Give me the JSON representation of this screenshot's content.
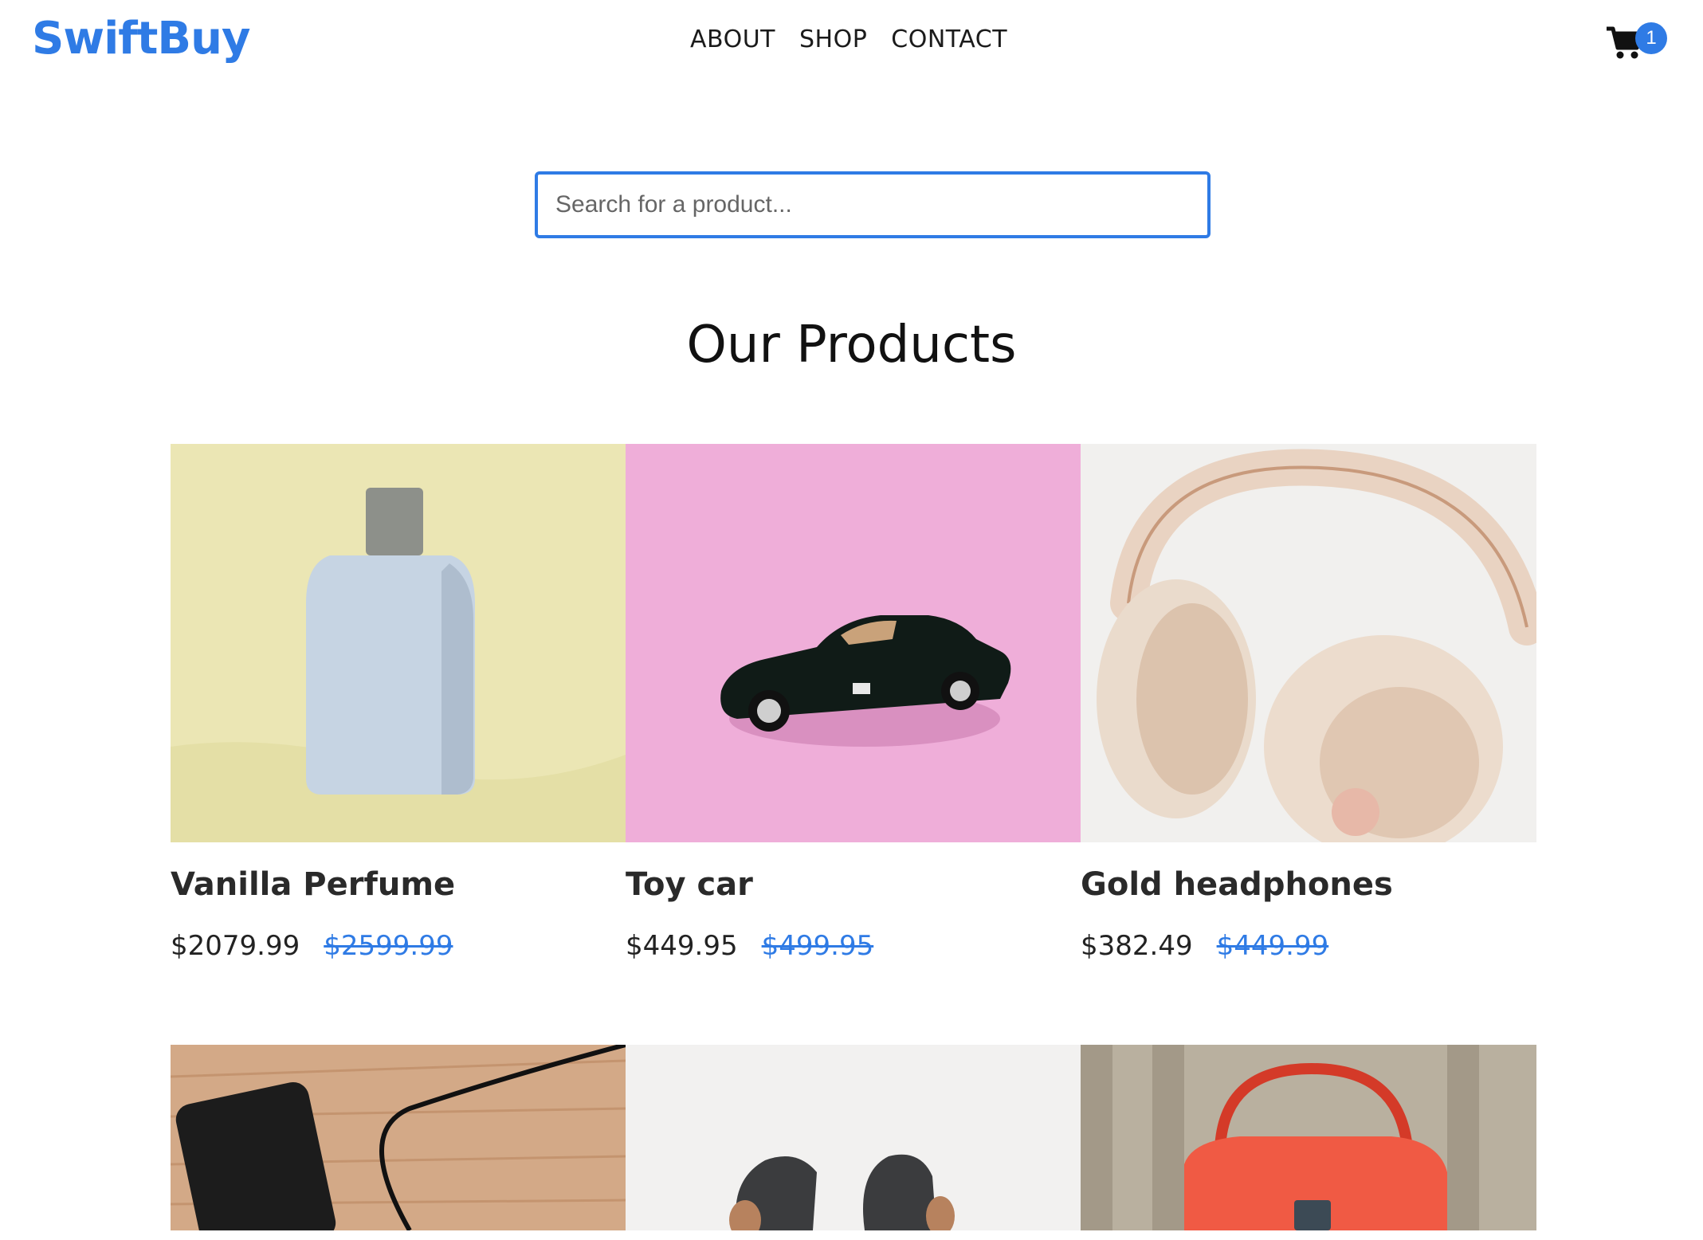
{
  "brand": {
    "name": "SwiftBuy",
    "color": "#2f7be5"
  },
  "nav": [
    {
      "label": "ABOUT"
    },
    {
      "label": "SHOP"
    },
    {
      "label": "CONTACT"
    }
  ],
  "cart": {
    "icon": "cart-icon",
    "count": "1"
  },
  "search": {
    "placeholder": "Search for a product..."
  },
  "section": {
    "title": "Our Products"
  },
  "products": [
    {
      "name": "Vanilla Perfume",
      "price": "$2079.99",
      "old_price": "$2599.99",
      "image": "perfume-bottle"
    },
    {
      "name": "Toy car",
      "price": "$449.95",
      "old_price": "$499.95",
      "image": "toy-car"
    },
    {
      "name": "Gold headphones",
      "price": "$382.49",
      "old_price": "$449.99",
      "image": "headphones"
    },
    {
      "name": "",
      "price": "",
      "old_price": "",
      "image": "power-bank"
    },
    {
      "name": "",
      "price": "",
      "old_price": "",
      "image": "earbuds"
    },
    {
      "name": "",
      "price": "",
      "old_price": "",
      "image": "handbag"
    }
  ]
}
